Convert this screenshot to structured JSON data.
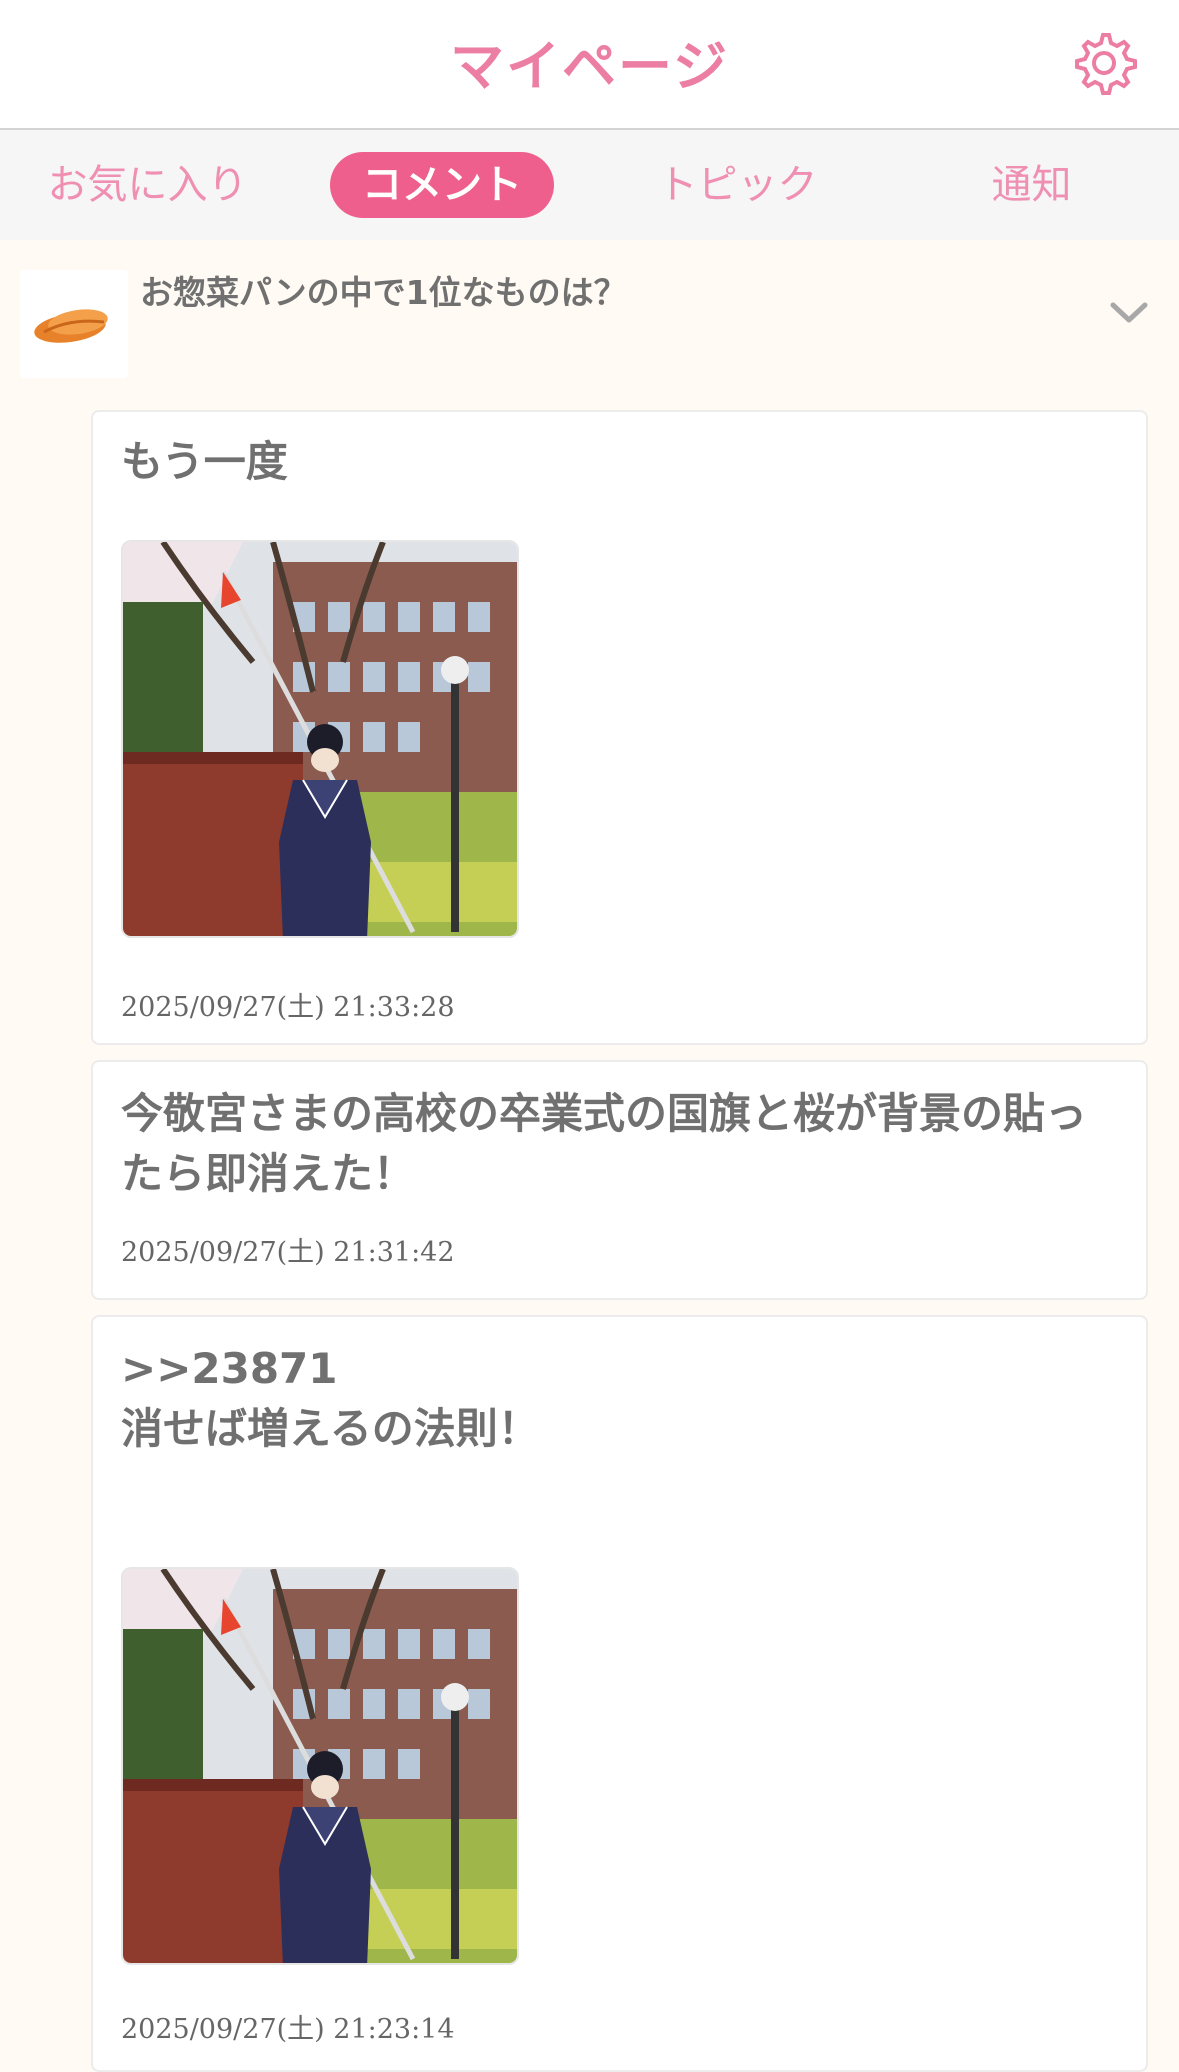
{
  "header": {
    "title": "マイページ",
    "settings_icon": "gear-icon",
    "accent": "#ec7da3"
  },
  "tabs": [
    {
      "label": "お気に入り",
      "active": false
    },
    {
      "label": "コメント",
      "active": true
    },
    {
      "label": "トピック",
      "active": false
    },
    {
      "label": "通知",
      "active": false
    }
  ],
  "topic": {
    "title": "お惣菜パンの中で1位なものは？",
    "thumb_icon": "bread-icon",
    "expand_icon": "chevron-down-icon"
  },
  "comments": [
    {
      "text": "もう一度",
      "has_image": true,
      "date": "2025/09/27(土) 21:33:28"
    },
    {
      "text": "今敬宮さまの高校の卒業式の国旗と桜が背景の貼ったら即消えた！",
      "has_image": false,
      "date": "2025/09/27(土) 21:31:42"
    },
    {
      "text": ">>23871\n消せば増えるの法則！",
      "has_image": true,
      "date": "2025/09/27(土) 21:23:14"
    }
  ]
}
